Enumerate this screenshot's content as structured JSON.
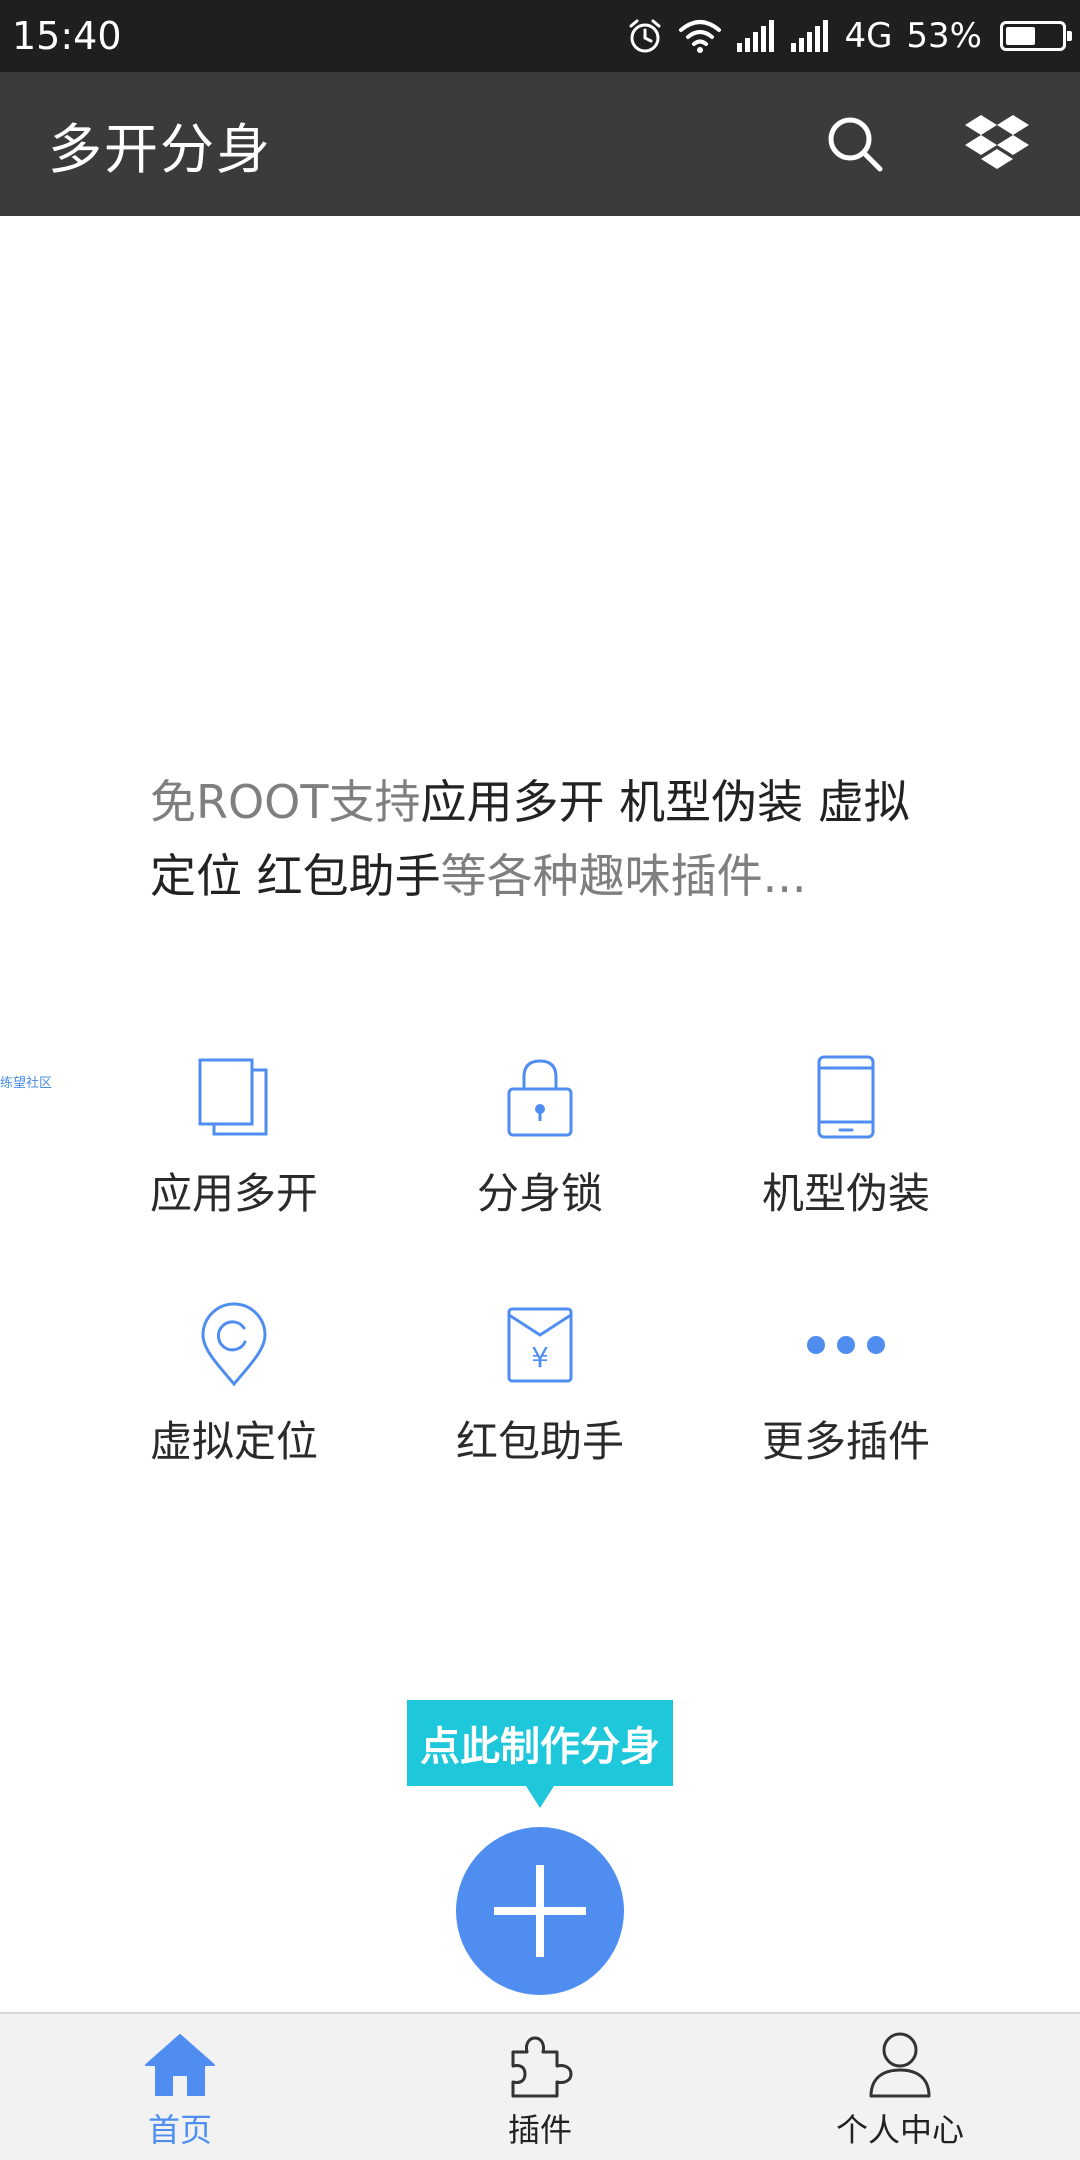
{
  "status_bar": {
    "time": "15:40",
    "network": "4G",
    "battery_text": "53%",
    "battery_level": 0.53,
    "icons": [
      "alarm-icon",
      "wifi-icon",
      "signal-icon",
      "signal-icon"
    ]
  },
  "app_bar": {
    "title": "多开分身",
    "actions": [
      "search-icon",
      "dropbox-icon"
    ]
  },
  "intro": {
    "p1": "免ROOT支持",
    "h1": "应用多开 机型伪装 虚拟定位 红包助手",
    "p2": "等各种趣味插件..."
  },
  "side_tag": "练望社区",
  "features": [
    {
      "label": "应用多开",
      "icon": "copy-pages-icon"
    },
    {
      "label": "分身锁",
      "icon": "lock-icon"
    },
    {
      "label": "机型伪装",
      "icon": "phone-icon"
    },
    {
      "label": "虚拟定位",
      "icon": "location-pin-icon"
    },
    {
      "label": "红包助手",
      "icon": "red-envelope-yuan-icon"
    },
    {
      "label": "更多插件",
      "icon": "more-dots-icon"
    }
  ],
  "create": {
    "tooltip": "点此制作分身",
    "fab_icon": "plus-icon"
  },
  "bottom_nav": [
    {
      "label": "首页",
      "icon": "home-icon",
      "active": true
    },
    {
      "label": "插件",
      "icon": "puzzle-icon",
      "active": false
    },
    {
      "label": "个人中心",
      "icon": "person-icon",
      "active": false
    }
  ],
  "colors": {
    "accent": "#4f8ef0",
    "tooltip": "#1ec8da",
    "app_bar": "#3b3b3b",
    "status_bar": "#1f1f1f"
  }
}
